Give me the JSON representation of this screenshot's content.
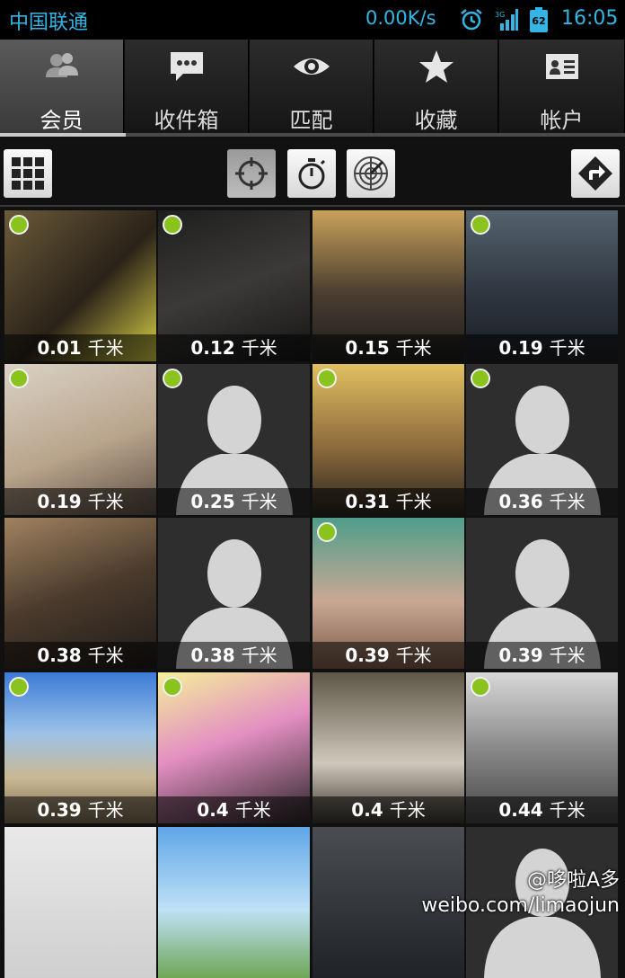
{
  "status": {
    "carrier": "中国联通",
    "speed": "0.00K/s",
    "battery": "62",
    "time": "16:05"
  },
  "tabs": [
    {
      "label": "会员",
      "icon": "members-icon",
      "active": true
    },
    {
      "label": "收件箱",
      "icon": "chat-bubble-icon",
      "active": false
    },
    {
      "label": "匹配",
      "icon": "eye-icon",
      "active": false
    },
    {
      "label": "收藏",
      "icon": "star-icon",
      "active": false
    },
    {
      "label": "帐户",
      "icon": "id-card-icon",
      "active": false
    }
  ],
  "toolbar": {
    "grid_icon": "grid-view-icon",
    "nearby_icon": "crosshair-icon",
    "recent_icon": "stopwatch-icon",
    "radar_icon": "radar-icon",
    "directions_icon": "directions-icon"
  },
  "members": [
    {
      "distance": "0.01",
      "online": true,
      "photo": "person"
    },
    {
      "distance": "0.12",
      "online": true,
      "photo": "person"
    },
    {
      "distance": "0.15",
      "online": false,
      "photo": "person"
    },
    {
      "distance": "0.19",
      "online": true,
      "photo": "person"
    },
    {
      "distance": "0.19",
      "online": true,
      "photo": "person"
    },
    {
      "distance": "0.25",
      "online": true,
      "photo": "silhouette"
    },
    {
      "distance": "0.31",
      "online": true,
      "photo": "person"
    },
    {
      "distance": "0.36",
      "online": true,
      "photo": "silhouette"
    },
    {
      "distance": "0.38",
      "online": false,
      "photo": "person"
    },
    {
      "distance": "0.38",
      "online": false,
      "photo": "silhouette"
    },
    {
      "distance": "0.39",
      "online": true,
      "photo": "person"
    },
    {
      "distance": "0.39",
      "online": false,
      "photo": "silhouette"
    },
    {
      "distance": "0.39",
      "online": true,
      "photo": "person"
    },
    {
      "distance": "0.4",
      "online": true,
      "photo": "person"
    },
    {
      "distance": "0.4",
      "online": false,
      "photo": "person"
    },
    {
      "distance": "0.44",
      "online": true,
      "photo": "person"
    },
    {
      "distance": "",
      "online": false,
      "photo": "person"
    },
    {
      "distance": "",
      "online": false,
      "photo": "person"
    },
    {
      "distance": "",
      "online": false,
      "photo": "person"
    },
    {
      "distance": "",
      "online": false,
      "photo": "silhouette"
    }
  ],
  "distance_unit": "千米",
  "watermark": {
    "handle": "@哆啦A多",
    "url": "weibo.com/limaojun"
  }
}
